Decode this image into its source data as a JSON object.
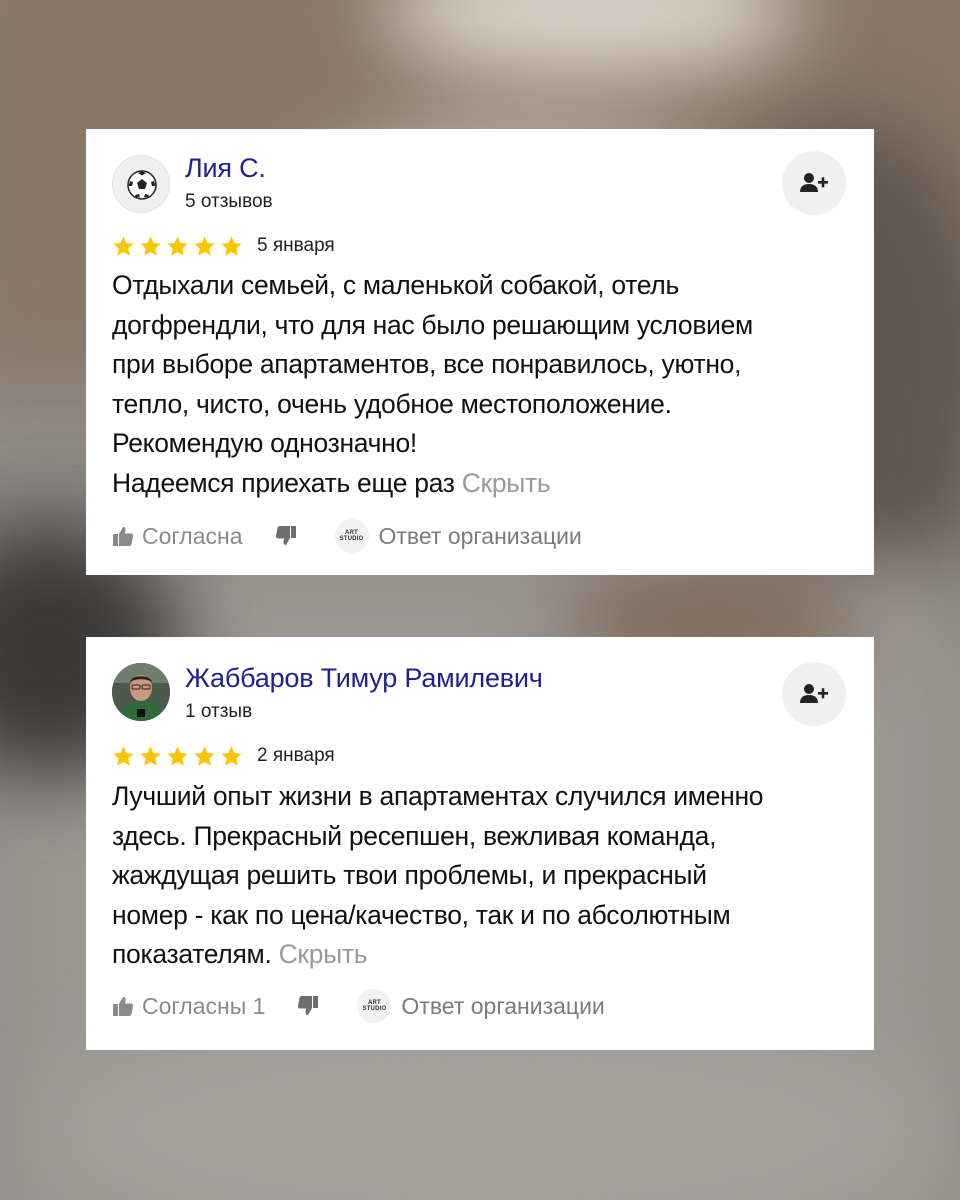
{
  "colors": {
    "author_link": "#21208f",
    "star": "#fcc400",
    "muted_text": "#9a9a9a"
  },
  "reviews": [
    {
      "author": "Лия С.",
      "review_count": "5 отзывов",
      "avatar_icon": "soccer-ball-icon",
      "rating": 5,
      "date": "5 января",
      "text_lines": [
        "Отдыхали семьей, с маленькой собакой, отель",
        "догфрендли, что для нас было решающим условием",
        "при выборе апартаментов, все понравилось, уютно,",
        "тепло, чисто, очень удобное местоположение.",
        "Рекомендую однозначно!",
        "Надеемся приехать еще раз"
      ],
      "hide_label": "Скрыть",
      "like_label": "Согласна",
      "org_logo": [
        "ART",
        "STUDIO"
      ],
      "org_reply_label": "Ответ организации"
    },
    {
      "author": "Жаббаров Тимур Рамилевич",
      "review_count": "1 отзыв",
      "avatar_icon": "user-photo",
      "rating": 5,
      "date": "2 января",
      "text_lines": [
        "Лучший опыт жизни в апартаментах случился именно",
        "здесь. Прекрасный ресепшен, вежливая команда,",
        "жаждущая решить твои проблемы, и прекрасный",
        "номер - как по цена/качество, так и по абсолютным",
        "показателям."
      ],
      "hide_label": "Скрыть",
      "like_label": "Согласны 1",
      "org_logo": [
        "ART",
        "STUDIO"
      ],
      "org_reply_label": "Ответ организации"
    }
  ]
}
